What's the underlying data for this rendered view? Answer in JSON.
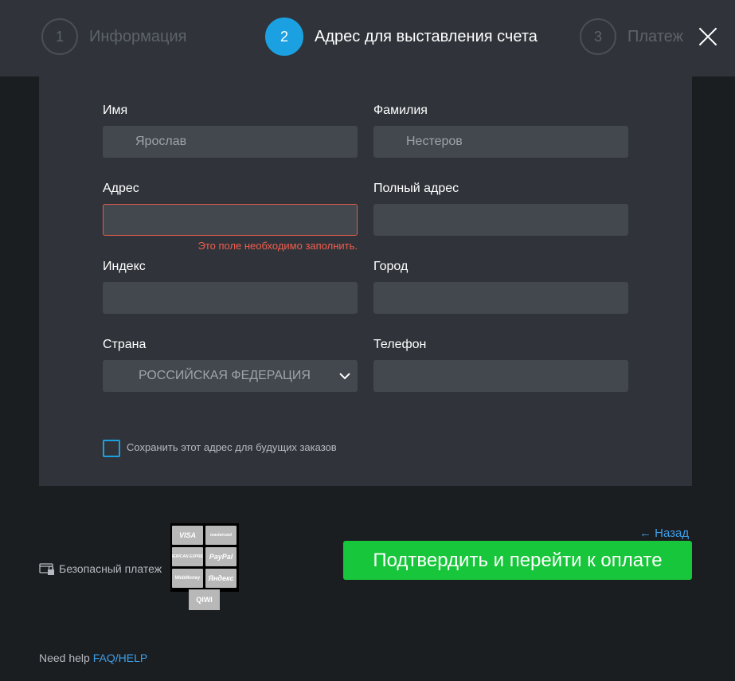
{
  "steps": [
    {
      "number": "1",
      "label": "Информация"
    },
    {
      "number": "2",
      "label": "Адрес для выставления счета"
    },
    {
      "number": "3",
      "label": "Платеж"
    }
  ],
  "form": {
    "first_name": {
      "label": "Имя",
      "value": "Ярослав"
    },
    "last_name": {
      "label": "Фамилия",
      "value": "Нестеров"
    },
    "address": {
      "label": "Адрес",
      "value": "",
      "error": "Это поле необходимо заполнить."
    },
    "full_address": {
      "label": "Полный адрес",
      "value": ""
    },
    "zip": {
      "label": "Индекс",
      "value": ""
    },
    "city": {
      "label": "Город",
      "value": ""
    },
    "country": {
      "label": "Страна",
      "value": "РОССИЙСКАЯ ФЕДЕРАЦИЯ"
    },
    "phone": {
      "label": "Телефон",
      "value": ""
    },
    "save_address": {
      "label": "Сохранить этот адрес для будущих заказов",
      "checked": false
    }
  },
  "footer": {
    "secure_label": "Безопасный платеж",
    "back_label": "← Назад",
    "confirm_label": "Подтвердить и перейти к оплате",
    "help_text": "Need help",
    "help_link": "FAQ/HELP"
  },
  "payment_methods": [
    "VISA",
    "mastercard",
    "AMERICAN EXPRESS",
    "PayPal",
    "WebMoney",
    "Яндекс",
    "QIWI"
  ],
  "colors": {
    "accent": "#1ba1e2",
    "confirm": "#17c63a",
    "error": "#ef5d4d",
    "link": "#3d9fe8"
  }
}
